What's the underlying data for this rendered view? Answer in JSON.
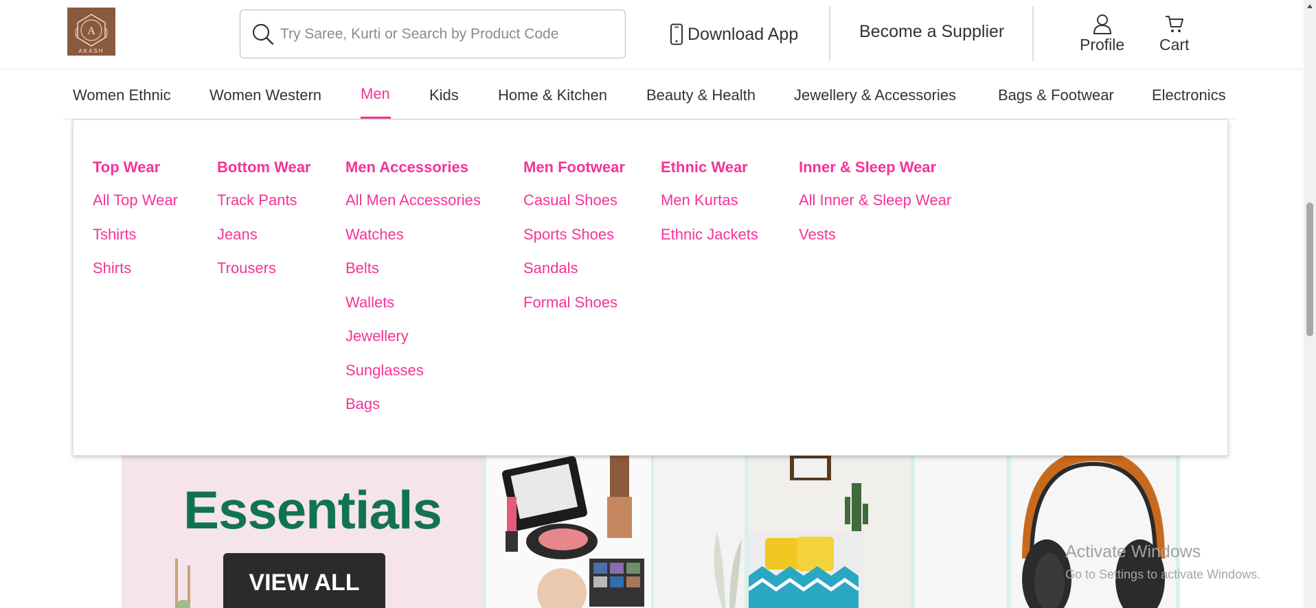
{
  "brand": {
    "logo_letter": "A",
    "logo_name": "AKASH"
  },
  "search": {
    "placeholder": "Try Saree, Kurti or Search by Product Code"
  },
  "header": {
    "download_app": "Download App",
    "become_supplier": "Become a Supplier",
    "profile": "Profile",
    "cart": "Cart"
  },
  "categories": [
    "Women Ethnic",
    "Women Western",
    "Men",
    "Kids",
    "Home & Kitchen",
    "Beauty & Health",
    "Jewellery & Accessories",
    "Bags & Footwear",
    "Electronics"
  ],
  "active_category": "Men",
  "mega_menu": [
    {
      "heading": "Top Wear",
      "items": [
        "All Top Wear",
        "Tshirts",
        "Shirts"
      ]
    },
    {
      "heading": "Bottom Wear",
      "items": [
        "Track Pants",
        "Jeans",
        "Trousers"
      ]
    },
    {
      "heading": "Men Accessories",
      "items": [
        "All Men Accessories",
        "Watches",
        "Belts",
        "Wallets",
        "Jewellery",
        "Sunglasses",
        "Bags"
      ]
    },
    {
      "heading": "Men Footwear",
      "items": [
        "Casual Shoes",
        "Sports Shoes",
        "Sandals",
        "Formal Shoes"
      ]
    },
    {
      "heading": "Ethnic Wear",
      "items": [
        "Men Kurtas",
        "Ethnic Jackets"
      ]
    },
    {
      "heading": "Inner & Sleep Wear",
      "items": [
        "All Inner & Sleep Wear",
        "Vests"
      ]
    }
  ],
  "banner": {
    "headline": "Essentials",
    "cta": "VIEW ALL"
  },
  "watermark": {
    "line1": "Activate Windows",
    "line2": "Go to Settings to activate Windows."
  },
  "colors": {
    "accent": "#f43397",
    "brand_bg": "#8a5a3c",
    "essentials_green": "#12734f"
  }
}
